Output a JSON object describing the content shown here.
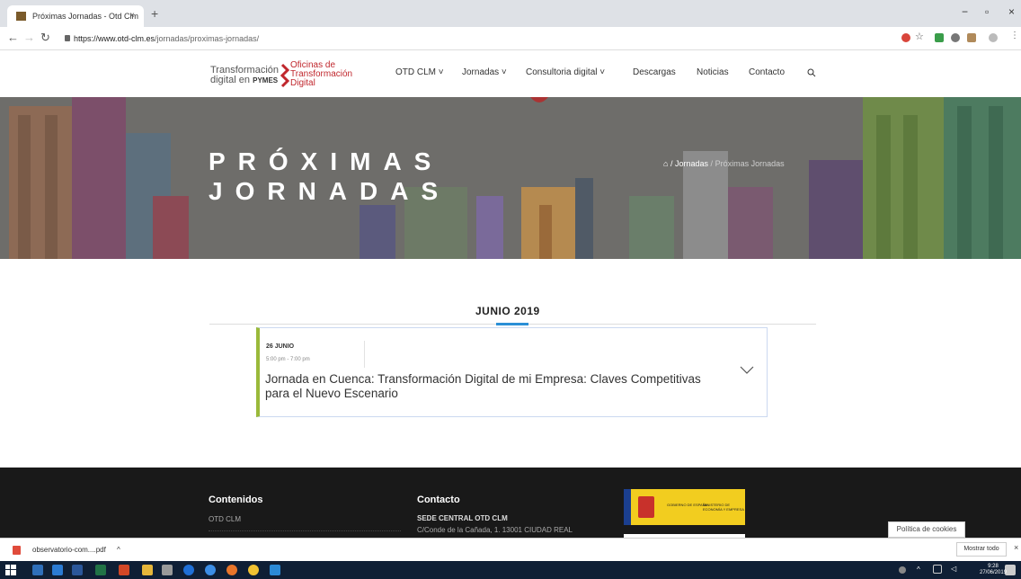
{
  "browser": {
    "tab_title": "Próximas Jornadas - Otd Clm",
    "tab_close": "×",
    "new_tab": "+",
    "url_host": "https://www.otd-clm.es",
    "url_path": "/jornadas/proximas-jornadas/"
  },
  "site": {
    "logo_line1": "Transformación",
    "logo_line2_prefix": "digital en",
    "logo_line2_bold": "PYMES",
    "logo2_line1": "Oficinas de",
    "logo2_line2": "Transformación",
    "logo2_line3": "Digital",
    "menu": [
      {
        "label": "OTD CLM ˅"
      },
      {
        "label": "Jornadas ˅"
      },
      {
        "label": "Consultoria digital ˅"
      },
      {
        "label": "Descargas"
      },
      {
        "label": "Noticias"
      },
      {
        "label": "Contacto"
      }
    ]
  },
  "hero": {
    "title_line1": "PRÓXIMAS",
    "title_line2": "JORNADAS",
    "breadcrumb_home_sep": "/",
    "breadcrumb_jornadas": "Jornadas",
    "breadcrumb_sep": "/",
    "breadcrumb_current": "Próximas Jornadas"
  },
  "events": {
    "month": "JUNIO 2019",
    "items": [
      {
        "date": "26 JUNIO",
        "time": "5:00 pm - 7:00 pm",
        "title": "Jornada en Cuenca: Transformación Digital de mi Empresa: Claves Competitivas para el Nuevo Escenario"
      }
    ]
  },
  "footer": {
    "col1_heading": "Contenidos",
    "col1_item": "OTD CLM",
    "col2_heading": "Contacto",
    "col2_line1": "SEDE CENTRAL OTD CLM",
    "col2_line2": "C/Conde de la Cañada, 1. 13001 CIUDAD REAL",
    "gov_left": "GOBIERNO DE ESPAÑA",
    "gov_right": "MINISTERIO DE ECONOMÍA Y EMPRESA",
    "cookies": "Política de cookies"
  },
  "downloads": {
    "file": "observatorio-com....pdf",
    "chevron": "^",
    "show_all": "Mostrar todo",
    "close": "×"
  },
  "taskbar": {
    "time": "9:28",
    "date": "27/06/2019"
  }
}
